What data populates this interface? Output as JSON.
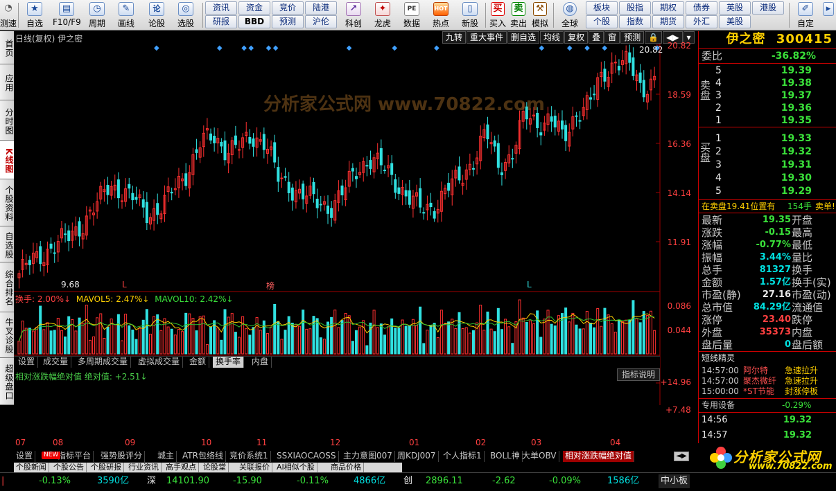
{
  "toolbar": {
    "left_buttons": [
      {
        "label": "测速",
        "icon": "speed-icon"
      },
      {
        "label": "自选",
        "icon": "star-icon"
      },
      {
        "label": "F10/F9",
        "icon": "f10-icon"
      },
      {
        "label": "周期",
        "icon": "clock-icon"
      },
      {
        "label": "画线",
        "icon": "pencil-icon"
      },
      {
        "label": "论股",
        "icon": "discuss-icon"
      },
      {
        "label": "选股",
        "icon": "select-stock-icon"
      }
    ],
    "grid_row1": [
      "资讯",
      "资金",
      "竞价",
      "陆港"
    ],
    "grid_row2": [
      "研报",
      "BBD",
      "预测",
      "沪伦"
    ],
    "mid_buttons": [
      {
        "label": "科创",
        "icon": "kechuang-icon"
      },
      {
        "label": "龙虎",
        "icon": "dragon-tiger-icon"
      },
      {
        "label": "数据",
        "icon": "data-icon",
        "glyph": "PE"
      },
      {
        "label": "热点",
        "icon": "hot-icon",
        "glyph": "HOT"
      },
      {
        "label": "新股",
        "icon": "ipo-icon"
      }
    ],
    "trade_buttons": [
      {
        "label": "买入",
        "glyph": "买",
        "color": "#d00000"
      },
      {
        "label": "卖出",
        "glyph": "卖",
        "color": "#008000"
      },
      {
        "label": "模拟",
        "glyph": "⚒",
        "color": "#8a4a00"
      }
    ],
    "globe": {
      "label": "全球"
    },
    "grid2_row1": [
      "板块",
      "股指",
      "期权",
      "债券",
      "英股",
      "港股"
    ],
    "grid2_row2": [
      "个股",
      "指数",
      "期货",
      "外汇",
      "美股"
    ],
    "hl_row1": [
      false,
      false,
      false,
      false,
      false,
      false
    ],
    "custom": {
      "label": "自定"
    }
  },
  "left_tabs": [
    {
      "label": "首页",
      "active": false
    },
    {
      "label": "应用",
      "active": false
    },
    {
      "label": "分时图",
      "active": false
    },
    {
      "label": "K线图",
      "active": true
    },
    {
      "label": "个股资料",
      "active": false
    },
    {
      "label": "自选股",
      "active": false
    },
    {
      "label": "综合排名",
      "active": false
    },
    {
      "label": "牛叉诊股",
      "active": false
    },
    {
      "label": "超级盘口",
      "active": false
    }
  ],
  "chart": {
    "title": "日线(复权)  伊之密",
    "tools": [
      "九转",
      "重大事件",
      "删自选",
      "均线",
      "复权",
      "叠",
      "窗",
      "预测",
      "🔒",
      "◀▶",
      "▾"
    ],
    "price_labels": [
      "20.82",
      "18.59",
      "16.36",
      "14.14",
      "11.91"
    ],
    "high_marker": "20.82",
    "low_marker": "9.68",
    "signal_markers": [
      "L",
      "榜",
      "L"
    ],
    "volume_legend": {
      "hs": "换手: 2.00%↓",
      "ma5": "MAVOL5: 2.47%↓",
      "ma10": "MAVOL10: 2.42%↓"
    },
    "volume_axis": [
      "0.086",
      "0.044"
    ],
    "indicator_tabs": [
      "设置",
      "成交量",
      "多周期成交量",
      "虚拟成交量",
      "金额",
      "换手率",
      "内盘"
    ],
    "indicator_active": 5,
    "indicator_legend": "相对涨跌幅绝对值  绝对值: +2.51↓",
    "indicator_help": "指标说明",
    "indicator_axis": [
      "+14.96",
      "+7.48"
    ],
    "months": [
      "07",
      "08",
      "09",
      "10",
      "11",
      "12",
      "01",
      "02",
      "03",
      "04"
    ],
    "watermark": "分析家公式网 www.70822.com",
    "watermark2": "www.70822.com"
  },
  "chart_data": {
    "type": "candlestick",
    "title": "日线(复权) 伊之密",
    "ylim": [
      9.68,
      20.82
    ],
    "x_labels": [
      "07",
      "08",
      "09",
      "10",
      "11",
      "12",
      "01",
      "02",
      "03",
      "04"
    ],
    "close_series": [
      10.2,
      10.8,
      11.2,
      11.6,
      12.0,
      12.6,
      13.4,
      14.4,
      14.0,
      13.6,
      13.0,
      13.3,
      14.2,
      15.0,
      16.3,
      16.6,
      16.0,
      16.1,
      16.6,
      16.4,
      14.6,
      14.2,
      13.9,
      13.5,
      13.3,
      14.0,
      15.0,
      15.6,
      15.2,
      14.5,
      13.8,
      13.2,
      13.3,
      14.2,
      14.6,
      15.5,
      16.8,
      15.2,
      15.8,
      17.6,
      17.2,
      17.5,
      16.4,
      17.8,
      18.2,
      19.4,
      20.2,
      20.0,
      18.8,
      19.35
    ],
    "turnover_pct_last": 2.0,
    "mavol5": 2.47,
    "mavol10": 2.42,
    "indicator_last": 2.51,
    "indicator_ylim": [
      0,
      14.96
    ]
  },
  "quote": {
    "name": "伊之密",
    "code": "300415",
    "wb_label": "委比",
    "wb_value": "-36.82%",
    "sell_label": "卖盘",
    "buy_label": "买盘",
    "asks": [
      {
        "lvl": "5",
        "price": "19.39"
      },
      {
        "lvl": "4",
        "price": "19.38"
      },
      {
        "lvl": "3",
        "price": "19.37"
      },
      {
        "lvl": "2",
        "price": "19.36"
      },
      {
        "lvl": "1",
        "price": "19.35"
      }
    ],
    "bids": [
      {
        "lvl": "1",
        "price": "19.33"
      },
      {
        "lvl": "2",
        "price": "19.32"
      },
      {
        "lvl": "3",
        "price": "19.31"
      },
      {
        "lvl": "4",
        "price": "19.30"
      },
      {
        "lvl": "5",
        "price": "19.29"
      }
    ],
    "notice": "在卖盘19.41位置有",
    "notice_qty": "154手",
    "notice_tail": "卖单!",
    "stats": [
      {
        "k": "最新",
        "v": "19.35",
        "c": "green",
        "k2": "开盘"
      },
      {
        "k": "涨跌",
        "v": "-0.15",
        "c": "green",
        "k2": "最高"
      },
      {
        "k": "涨幅",
        "v": "-0.77%",
        "c": "green",
        "k2": "最低"
      },
      {
        "k": "振幅",
        "v": "3.44%",
        "c": "cyan",
        "k2": "量比"
      },
      {
        "k": "总手",
        "v": "81327",
        "c": "cyan",
        "k2": "换手"
      },
      {
        "k": "金额",
        "v": "1.57亿",
        "c": "cyan",
        "k2": "换手(实)"
      },
      {
        "k": "市盈(静)",
        "v": "27.16",
        "c": "white",
        "k2": "市盈(动)"
      },
      {
        "k": "总市值",
        "v": "84.29亿",
        "c": "cyan",
        "k2": "流通值"
      },
      {
        "k": "涨停",
        "v": "23.40",
        "c": "red",
        "k2": "跌停"
      },
      {
        "k": "外盘",
        "v": "35373",
        "c": "red",
        "k2": "内盘"
      },
      {
        "k": "盘后量",
        "v": "0",
        "c": "cyan",
        "k2": "盘后额"
      }
    ],
    "spirit_title": "短线精灵",
    "spirit": [
      {
        "t": "14:57:00",
        "n": "阿尔特",
        "e": "急速拉升"
      },
      {
        "t": "14:57:00",
        "n": "聚杰微纤",
        "e": "急速拉升"
      },
      {
        "t": "15:00:00",
        "n": "*ST节能",
        "e": "封涨停板"
      }
    ],
    "device_label": "专用设备",
    "device_value": "-0.29%",
    "ticks": [
      {
        "t": "14:56",
        "p": "19.32"
      },
      {
        "t": "14:57",
        "p": "19.32"
      }
    ]
  },
  "bottom_tabs": [
    "设置",
    "指标平台",
    "强势股评分",
    "城主",
    "ATR包络线",
    "竞价系统1",
    "SSXIAOCAOSS",
    "主力意图007",
    "周KDJ007",
    "个人指标1",
    "BOLL神",
    "大单OBV",
    "相对涨跌幅绝对值"
  ],
  "bottom_active": 12,
  "new_badge": "NEW",
  "bar2": [
    "个股新闻",
    "个股公告",
    "个股研报",
    "行业资讯",
    "高手观点",
    "论股堂",
    "关联报价",
    "AI相似个股",
    "商品价格"
  ],
  "status": {
    "sh_val": "-0.13%",
    "sh_amt": "3590亿",
    "sz_label": "深",
    "sz_idx": "14101.90",
    "sz_chg": "-15.90",
    "sz_pct": "-0.11%",
    "sz_amt": "4866亿",
    "cy_label": "创",
    "cy_idx": "2896.11",
    "cy_chg": "-2.62",
    "cy_pct": "-0.09%",
    "cy_amt": "1586亿",
    "zx_label": "中小板"
  },
  "logo": {
    "line1": "分析家公式网",
    "line2": "www.70822.com"
  },
  "colors": {
    "up": "#ff3030",
    "down": "#30e0e0",
    "accent": "#c00000",
    "ma5": "#ffd000",
    "ma10": "#30c030"
  }
}
